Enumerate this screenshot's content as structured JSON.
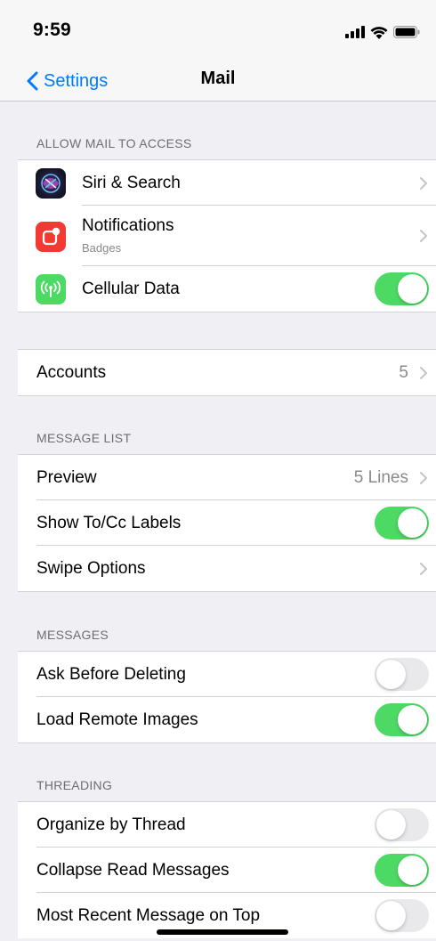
{
  "status": {
    "time": "9:59"
  },
  "nav": {
    "back_label": "Settings",
    "title": "Mail"
  },
  "sections": {
    "access_header": "ALLOW MAIL TO ACCESS",
    "message_list_header": "MESSAGE LIST",
    "messages_header": "MESSAGES",
    "threading_header": "THREADING"
  },
  "access": {
    "siri": {
      "label": "Siri & Search",
      "icon": "siri-icon"
    },
    "notifications": {
      "label": "Notifications",
      "subtitle": "Badges",
      "icon": "notifications-icon"
    },
    "cellular": {
      "label": "Cellular Data",
      "icon": "cellular-antenna-icon",
      "enabled": true
    }
  },
  "accounts": {
    "label": "Accounts",
    "value": "5"
  },
  "message_list": {
    "preview": {
      "label": "Preview",
      "value": "5 Lines"
    },
    "show_to_cc": {
      "label": "Show To/Cc Labels",
      "enabled": true
    },
    "swipe_options": {
      "label": "Swipe Options"
    }
  },
  "messages": {
    "ask_before_deleting": {
      "label": "Ask Before Deleting",
      "enabled": false
    },
    "load_remote_images": {
      "label": "Load Remote Images",
      "enabled": true
    }
  },
  "threading": {
    "organize_by_thread": {
      "label": "Organize by Thread",
      "enabled": false
    },
    "collapse_read": {
      "label": "Collapse Read Messages",
      "enabled": true
    },
    "most_recent_on_top": {
      "label": "Most Recent Message on Top",
      "enabled": false
    }
  },
  "colors": {
    "accent": "#007aff",
    "toggle_on": "#4cd964",
    "toggle_off": "#e9e9eb",
    "notifications_icon_bg": "#f23a33",
    "cellular_icon_bg": "#4cd964"
  }
}
